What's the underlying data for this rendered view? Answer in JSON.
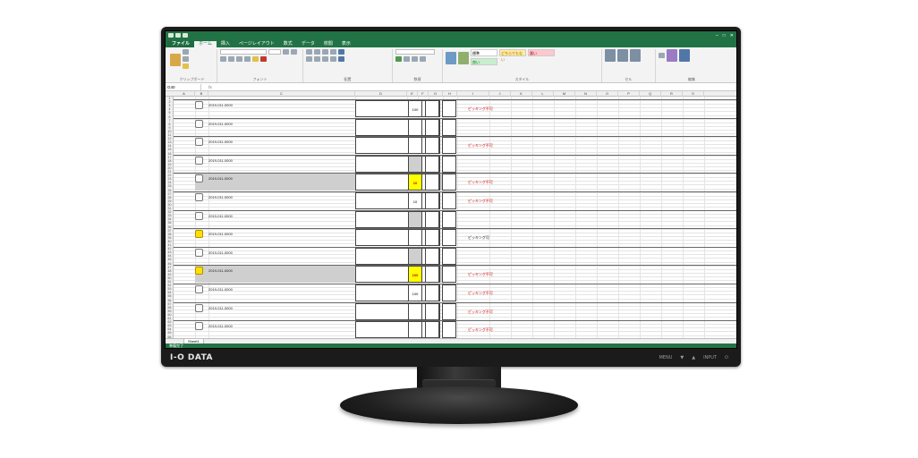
{
  "brand": {
    "logo": "I-O DATA"
  },
  "monitor_buttons": [
    "MENU",
    "▼",
    "▲",
    "INPUT",
    "⏻"
  ],
  "excel": {
    "title": "",
    "tabs": [
      "ファイル",
      "ホーム",
      "挿入",
      "ページレイアウト",
      "数式",
      "データ",
      "校閲",
      "表示"
    ],
    "ribbon_groups": [
      "クリップボード",
      "フォント",
      "配置",
      "数値",
      "スタイル",
      "セル",
      "編集"
    ],
    "styles": [
      {
        "label": "標準",
        "color": "#ffffff"
      },
      {
        "label": "どちらでもない",
        "color": "#ffeb9c"
      },
      {
        "label": "悪い",
        "color": "#ffc7ce"
      },
      {
        "label": "良い",
        "color": "#c6efce"
      }
    ],
    "name_box": "G40",
    "formula_bar": "",
    "sheet_tab": "Sheet1",
    "status": "準備完了"
  },
  "columns": [
    "A",
    "B",
    "C",
    "D",
    "E",
    "F",
    "G",
    "H",
    "I",
    "J",
    "K",
    "L",
    "M",
    "N",
    "O",
    "P",
    "Q",
    "R",
    "S"
  ],
  "row_numbers": [
    "1",
    "2",
    "3",
    "4",
    "5",
    "6",
    "7",
    "8",
    "9",
    "10",
    "11",
    "12",
    "13",
    "14",
    "15",
    "16",
    "17",
    "18",
    "19",
    "20",
    "21",
    "22",
    "23",
    "24",
    "25",
    "26",
    "27",
    "28",
    "29",
    "30",
    "31",
    "32",
    "33",
    "34",
    "35",
    "36",
    "37",
    "38",
    "39",
    "40",
    "41",
    "42",
    "43",
    "44",
    "45",
    "46",
    "47",
    "48",
    "49",
    "50",
    "51",
    "52",
    "53",
    "54",
    "55",
    "56",
    "57",
    "58",
    "59",
    "60",
    "61",
    "62",
    "63",
    "64",
    "65",
    "66"
  ],
  "records": [
    {
      "icon": "",
      "code": "2019-011-0000",
      "desc": "",
      "price": "",
      "qty": "100",
      "box": "",
      "status": "ピッキング不可",
      "status_color": "red",
      "qty_style": "normal",
      "highlight": false,
      "icon_style": "normal"
    },
    {
      "icon": "",
      "code": "2019-011-0000",
      "desc": "",
      "price": "",
      "qty": "",
      "box": "",
      "status": "",
      "status_color": "black",
      "qty_style": "normal",
      "highlight": false,
      "icon_style": "normal"
    },
    {
      "icon": "",
      "code": "2019-011-0000",
      "desc": "",
      "price": "",
      "qty": "",
      "box": "",
      "status": "ピッキング不可",
      "status_color": "red",
      "qty_style": "normal",
      "highlight": false,
      "icon_style": "normal"
    },
    {
      "icon": "",
      "code": "2019-011-0000",
      "desc": "",
      "price": "",
      "qty": "",
      "box": "",
      "status": "",
      "status_color": "black",
      "qty_style": "gray",
      "highlight": false,
      "icon_style": "normal"
    },
    {
      "icon": "",
      "code": "2019-011-0000",
      "desc": "",
      "price": "",
      "qty": "10",
      "box": "",
      "status": "ピッキング不可",
      "status_color": "red",
      "qty_style": "yellow",
      "highlight": true,
      "icon_style": "normal"
    },
    {
      "icon": "",
      "code": "2019-011-0000",
      "desc": "",
      "price": "",
      "qty": "10",
      "box": "",
      "status": "ピッキング不可",
      "status_color": "red",
      "qty_style": "normal",
      "highlight": false,
      "icon_style": "normal"
    },
    {
      "icon": "",
      "code": "2019-011-0000",
      "desc": "",
      "price": "",
      "qty": "",
      "box": "",
      "status": "",
      "status_color": "black",
      "qty_style": "gray",
      "highlight": false,
      "icon_style": "normal"
    },
    {
      "icon": "",
      "code": "2019-011-0000",
      "desc": "",
      "price": "",
      "qty": "",
      "box": "",
      "status": "ピッキング可",
      "status_color": "black",
      "qty_style": "normal",
      "highlight": false,
      "icon_style": "yellow"
    },
    {
      "icon": "",
      "code": "2019-011-0000",
      "desc": "",
      "price": "",
      "qty": "",
      "box": "",
      "status": "",
      "status_color": "black",
      "qty_style": "gray",
      "highlight": false,
      "icon_style": "normal"
    },
    {
      "icon": "",
      "code": "2019-011-0000",
      "desc": "",
      "price": "",
      "qty": "100",
      "box": "",
      "status": "ピッキング不可",
      "status_color": "red",
      "qty_style": "yellow",
      "highlight": true,
      "icon_style": "yellow"
    },
    {
      "icon": "",
      "code": "2019-011-0000",
      "desc": "",
      "price": "",
      "qty": "100",
      "box": "",
      "status": "ピッキング不可",
      "status_color": "red",
      "qty_style": "normal",
      "highlight": false,
      "icon_style": "normal"
    },
    {
      "icon": "",
      "code": "2019-011-0000",
      "desc": "",
      "price": "",
      "qty": "",
      "box": "",
      "status": "ピッキング不可",
      "status_color": "red",
      "qty_style": "normal",
      "highlight": false,
      "icon_style": "normal"
    },
    {
      "icon": "",
      "code": "2019-011-0000",
      "desc": "",
      "price": "",
      "qty": "",
      "box": "",
      "status": "ピッキング不可",
      "status_color": "red",
      "qty_style": "normal",
      "highlight": false,
      "icon_style": "normal"
    }
  ],
  "side_labels": [],
  "notes": [],
  "colors": {
    "excel_green": "#217346",
    "status_red": "#d40000",
    "highlight_yellow": "#ffff00"
  }
}
